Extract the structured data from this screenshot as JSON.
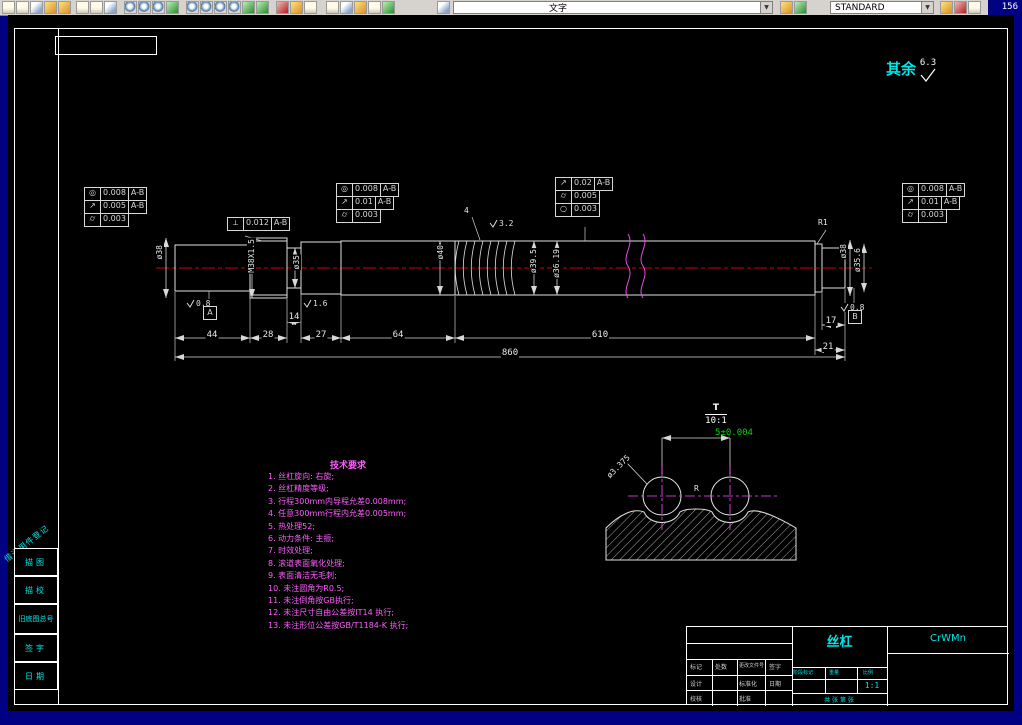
{
  "toolbar": {
    "counter": "156",
    "text_style_value": "文字",
    "dim_style_value": "STANDARD",
    "icons": [
      "print-icon",
      "print-preview-icon",
      "plot-settings-icon",
      "undo-icon",
      "redo-icon",
      "cut-icon",
      "copy-icon",
      "paste-icon",
      "pan-icon",
      "zoom-realtime-icon",
      "zoom-previous-icon",
      "regen-icon",
      "zoom-window-icon",
      "zoom-in-icon",
      "zoom-out-icon",
      "zoom-extents-icon",
      "layers-icon",
      "layer-properties-icon",
      "color-control-icon",
      "linetype-icon",
      "table-icon",
      "image-attach-icon",
      "block-icon",
      "hatch-icon",
      "text-style-icon",
      "lock-icon",
      "dim-update-icon",
      "pen-settings-icon",
      "standards-check-icon",
      "calculator-icon"
    ]
  },
  "icons": {
    "check": "√",
    "arrow": "▼"
  },
  "drawing": {
    "surface_default": {
      "label": "其余",
      "value": "6.3"
    },
    "gdt": {
      "f1r1": {
        "sym": "◎",
        "val": "0.008",
        "ref": "A-B"
      },
      "f1r2": {
        "sym": "↗",
        "val": "0.005",
        "ref": "A-B"
      },
      "f1r3": {
        "sym": "⌭",
        "val": "0.003"
      },
      "f2r1": {
        "sym": "⟂",
        "val": "0.012",
        "ref": "A-B"
      },
      "f3r1": {
        "sym": "◎",
        "val": "0.008",
        "ref": "A-B"
      },
      "f3r2": {
        "sym": "↗",
        "val": "0.01",
        "ref": "A-B"
      },
      "f3r3": {
        "sym": "⌭",
        "val": "0.003"
      },
      "f4r1": {
        "sym": "↗",
        "val": "0.02",
        "ref": "A-B"
      },
      "f4r2": {
        "sym": "⌭",
        "val": "0.005"
      },
      "f4r3": {
        "sym": "○",
        "val": "0.003"
      },
      "f5r1": {
        "sym": "◎",
        "val": "0.008",
        "ref": "A-B"
      },
      "f5r2": {
        "sym": "↗",
        "val": "0.01",
        "ref": "A-B"
      },
      "f5r3": {
        "sym": "⌭",
        "val": "0.003"
      }
    },
    "datums": {
      "a": "A",
      "b": "B"
    },
    "dims": {
      "d44": "44",
      "d28": "28",
      "d14": "14",
      "d27": "27",
      "d64": "64",
      "d610": "610",
      "d17": "17",
      "d21": "21",
      "total": "860"
    },
    "dia_labels": {
      "left": "ø38",
      "thread": "M38X1.5",
      "neck": "ø35",
      "mid": "ø40",
      "a": "ø39.5",
      "b": "ø36.19",
      "right_outer": "ø38",
      "right_end": "ø35.6"
    },
    "misc": {
      "r1": "R1",
      "groove": "4",
      "rough_32": "3.2",
      "rough_08l": "0.8",
      "rough_16": "1.6",
      "rough_08r": "0.8"
    },
    "detail": {
      "label": "T",
      "scale": "10:1",
      "dim": "5±0.004",
      "dia": "ø3.375",
      "radius": "R"
    },
    "notes": {
      "title": "技术要求",
      "items": [
        "1. 丝杠旋向: 右旋;",
        "2. 丝杠精度等级;",
        "3. 行程300mm内导程允差0.008mm;",
        "4. 任意300mm行程内允差0.005mm;",
        "5. 热处理52;",
        "6. 动力条件: 主振;",
        "7. 时效处理;",
        "8. 滚道表面氧化处理;",
        "9. 表面清洁无毛刺;",
        "10. 未注圆角为R0.5;",
        "11. 未注倒角按GB执行;",
        "12. 未注尺寸自由公差按IT14 执行;",
        "13. 未注形位公差按GB/T1184-K 执行;"
      ]
    },
    "title_block": {
      "part_name": "丝杠",
      "material": "CrWMn",
      "scale_value": "1:1",
      "labels": {
        "stage": "阶段标记",
        "weight": "重量",
        "scale": "比例",
        "sheets": "共 张",
        "sheet_no": "第 张",
        "mark": "标记",
        "count": "处数",
        "doc": "更改文件号",
        "sign": "签字",
        "date": "日期",
        "design": "设计",
        "standard": "标准化",
        "check": "校核",
        "approve": "批准"
      }
    },
    "side_panel": {
      "register": "借通用件登记",
      "box1": "描图",
      "box2": "描校",
      "box3": "旧底图总号",
      "box4": "签字",
      "box5": "日期"
    }
  }
}
